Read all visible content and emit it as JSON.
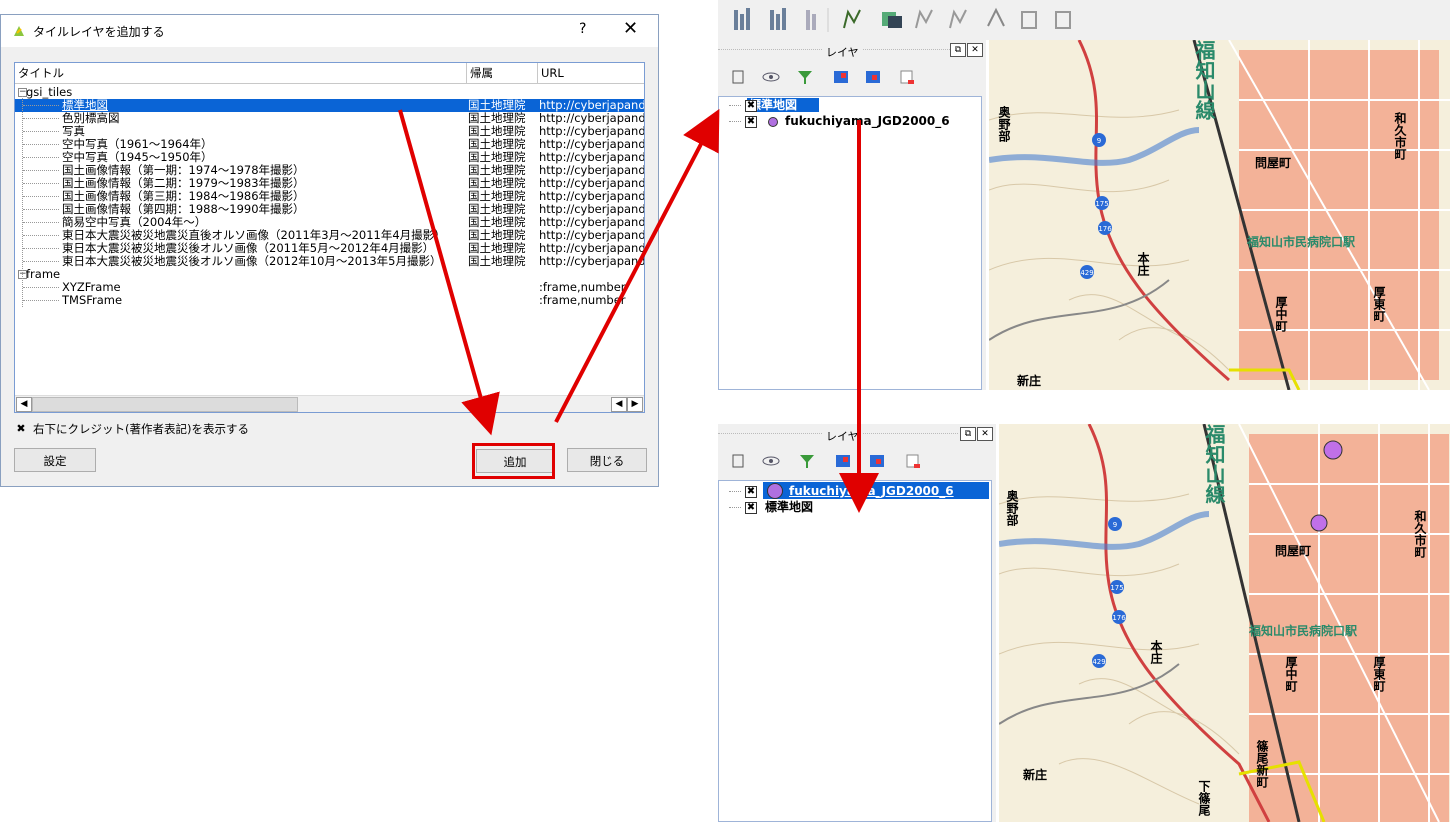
{
  "dialog": {
    "title": "タイルレイヤを追加する",
    "help": "?",
    "close": "✕",
    "columns": [
      "タイトル",
      "帰属",
      "URL"
    ],
    "rows": [
      {
        "title": "gsi_tiles",
        "owner": "",
        "url": "",
        "group": true
      },
      {
        "title": "標準地図",
        "owner": "国土地理院",
        "url": "http://cyberjapand",
        "selected": true
      },
      {
        "title": "色別標高図",
        "owner": "国土地理院",
        "url": "http://cyberjapand"
      },
      {
        "title": "写真",
        "owner": "国土地理院",
        "url": "http://cyberjapand"
      },
      {
        "title": "空中写真（1961～1964年）",
        "owner": "国土地理院",
        "url": "http://cyberjapand"
      },
      {
        "title": "空中写真（1945～1950年）",
        "owner": "国土地理院",
        "url": "http://cyberjapand"
      },
      {
        "title": "国土画像情報（第一期：1974～1978年撮影）",
        "owner": "国土地理院",
        "url": "http://cyberjapand"
      },
      {
        "title": "国土画像情報（第二期：1979～1983年撮影）",
        "owner": "国土地理院",
        "url": "http://cyberjapand"
      },
      {
        "title": "国土画像情報（第三期：1984～1986年撮影）",
        "owner": "国土地理院",
        "url": "http://cyberjapand"
      },
      {
        "title": "国土画像情報（第四期：1988～1990年撮影）",
        "owner": "国土地理院",
        "url": "http://cyberjapand"
      },
      {
        "title": "簡易空中写真（2004年～）",
        "owner": "国土地理院",
        "url": "http://cyberjapand"
      },
      {
        "title": "東日本大震災被災地震災直後オルソ画像（2011年3月～2011年4月撮影）",
        "owner": "国土地理院",
        "url": "http://cyberjapand"
      },
      {
        "title": "東日本大震災被災地震災後オルソ画像（2011年5月～2012年4月撮影）",
        "owner": "国土地理院",
        "url": "http://cyberjapand"
      },
      {
        "title": "東日本大震災被災地震災後オルソ画像（2012年10月～2013年5月撮影）",
        "owner": "国土地理院",
        "url": "http://cyberjapand"
      },
      {
        "title": "frame",
        "owner": "",
        "url": "",
        "group": true
      },
      {
        "title": "XYZFrame",
        "owner": "",
        "url": ":frame,number"
      },
      {
        "title": "TMSFrame",
        "owner": "",
        "url": ":frame,number"
      }
    ],
    "credit_label": "右下にクレジット(著作者表記)を表示する",
    "settings_button": "設定",
    "add_button": "追加",
    "close_button": "閉じる"
  },
  "layers_panel_top": {
    "title": "レイヤ",
    "items": [
      {
        "name": "標準地図",
        "selected": true,
        "symbol": false
      },
      {
        "name": "fukuchiyama_JGD2000_6",
        "selected": false,
        "symbol": true
      }
    ]
  },
  "layers_panel_bottom": {
    "title": "レイヤ",
    "items": [
      {
        "name": "fukuchiyama_JGD2000_6",
        "selected": true,
        "symbol": true
      },
      {
        "name": "標準地図",
        "selected": false,
        "symbol": false
      }
    ]
  },
  "map_labels": {
    "rail": "福知山線",
    "okuno": "奥野部",
    "toiya": "問屋町",
    "waku": "和久市町",
    "station": "福知山市民病院口駅",
    "motojo": "本庄",
    "atsunaka": "厚中町",
    "atsuhigashi": "厚東町",
    "shinjo": "新庄",
    "shinoo": "篠尾新町",
    "shimo": "下篠尾",
    "route9": "9",
    "route175": "175",
    "route176": "176",
    "route429": "429"
  },
  "colors": {
    "accent_red": "#e00000",
    "selection_blue": "#0a64d6",
    "point_purple": "#b070e0"
  }
}
